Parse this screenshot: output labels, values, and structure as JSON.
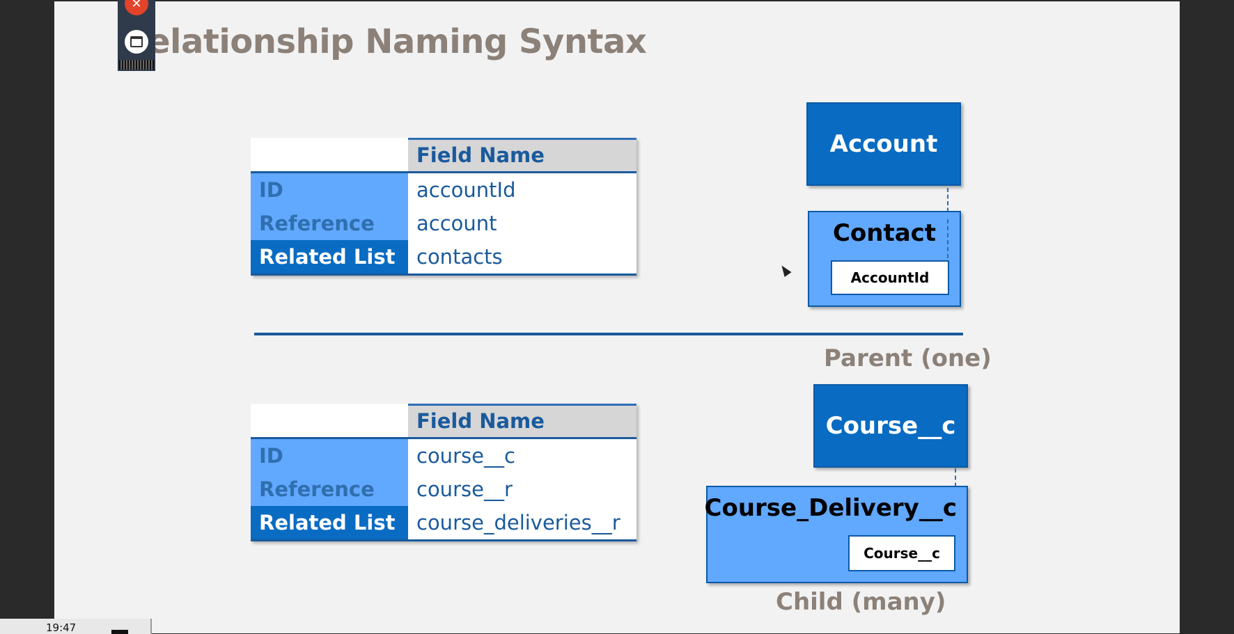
{
  "slide": {
    "title": "elationship Naming Syntax",
    "top_table": {
      "header": "Field Name",
      "rows": [
        {
          "label": "ID",
          "value": "accountId"
        },
        {
          "label": "Reference",
          "value": "account"
        },
        {
          "label": "Related List",
          "value": "contacts"
        }
      ]
    },
    "bottom_table": {
      "header": "Field Name",
      "rows": [
        {
          "label": "ID",
          "value": "course__c"
        },
        {
          "label": "Reference",
          "value": "course__r"
        },
        {
          "label": "Related List",
          "value": "course_deliveries__r"
        }
      ]
    },
    "diagram": {
      "parent_top": "Account",
      "child_top": "Contact",
      "child_top_field": "AccountId",
      "parent_bottom": "Course__c",
      "child_bottom": "Course_Delivery__c",
      "child_bottom_field": "Course__c",
      "parent_caption": "Parent (one)",
      "child_caption": "Child (many)"
    }
  },
  "taskbar": {
    "time": "19:47"
  },
  "colors": {
    "dark_blue": "#0a6bc2",
    "light_blue": "#61a8ff",
    "title_gray": "#8c8178"
  }
}
